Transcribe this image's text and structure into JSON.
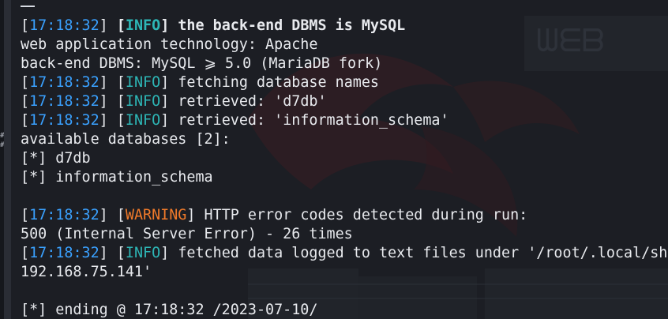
{
  "terminal": {
    "lines": [
      {
        "type": "log",
        "time": "17:18:32",
        "level": "INFO",
        "message": "the back-end DBMS is MySQL",
        "bold": true
      },
      {
        "type": "text",
        "text": "web application technology: Apache"
      },
      {
        "type": "text",
        "text": "back-end DBMS: MySQL ⩾ 5.0 (MariaDB fork)"
      },
      {
        "type": "log",
        "time": "17:18:32",
        "level": "INFO",
        "message": "fetching database names"
      },
      {
        "type": "log",
        "time": "17:18:32",
        "level": "INFO",
        "message": "retrieved: 'd7db'"
      },
      {
        "type": "log",
        "time": "17:18:32",
        "level": "INFO",
        "message": "retrieved: 'information_schema'"
      },
      {
        "type": "text",
        "text": "available databases [2]:"
      },
      {
        "type": "text",
        "text": "[*] d7db"
      },
      {
        "type": "text",
        "text": "[*] information_schema"
      },
      {
        "type": "blank",
        "text": ""
      },
      {
        "type": "log",
        "time": "17:18:32",
        "level": "WARNING",
        "message": "HTTP error codes detected during run:"
      },
      {
        "type": "text",
        "text": "500 (Internal Server Error) - 26 times"
      },
      {
        "type": "log",
        "time": "17:18:32",
        "level": "INFO",
        "message": "fetched data logged to text files under '/root/.local/share/sqlmap/output/"
      },
      {
        "type": "text",
        "text": "192.168.75.141'"
      },
      {
        "type": "blank",
        "text": ""
      },
      {
        "type": "text",
        "text": "[*] ending @ 17:18:32 /2023-07-10/"
      }
    ]
  },
  "colors": {
    "background": "#1c1e24",
    "timestamp": "#3aa1ff",
    "info": "#2db6b6",
    "warning": "#f07a2a",
    "text": "#e8eaee"
  }
}
